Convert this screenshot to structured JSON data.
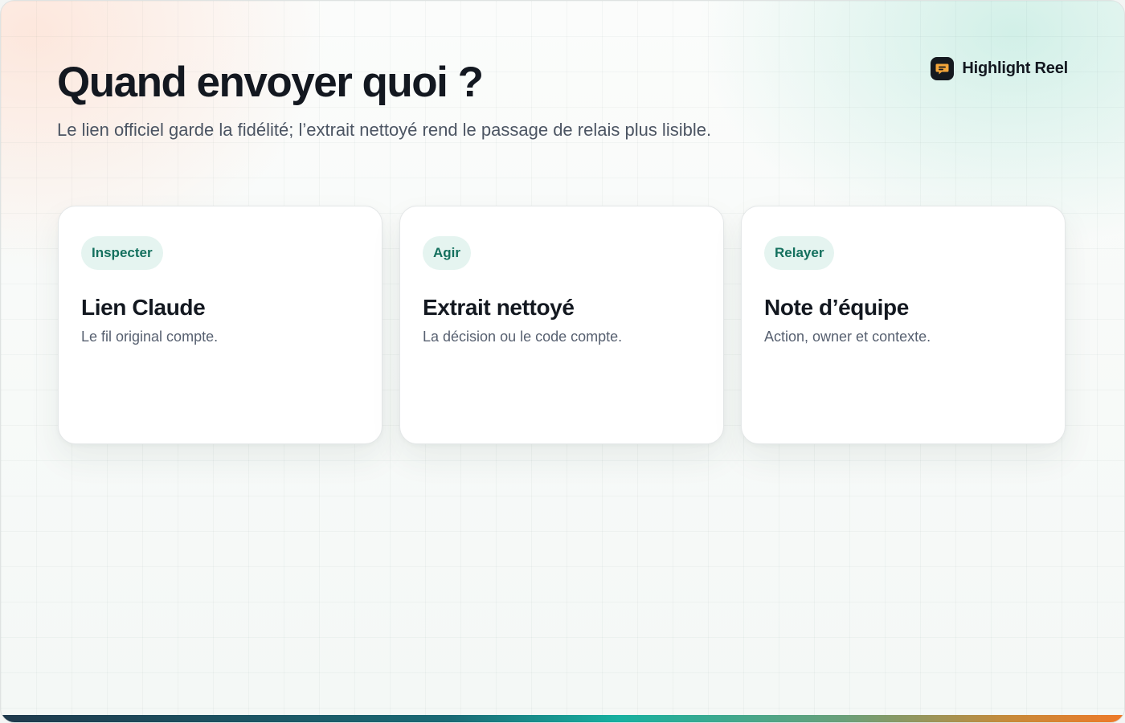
{
  "header": {
    "title": "Quand envoyer quoi ?",
    "subtitle": "Le lien officiel garde la fidélité; l’extrait nettoyé rend le passage de relais plus lisible."
  },
  "brand": {
    "name": "Highlight Reel",
    "icon": "speech-bubble-icon"
  },
  "cards": [
    {
      "tag": "Inspecter",
      "title": "Lien Claude",
      "description": "Le fil original compte."
    },
    {
      "tag": "Agir",
      "title": "Extrait nettoyé",
      "description": "La décision ou le code compte."
    },
    {
      "tag": "Relayer",
      "title": "Note d’équipe",
      "description": "Action, owner et contexte."
    }
  ],
  "colors": {
    "accent": "#14705e",
    "pill_background": "#e5f4f0",
    "title_text": "#131820",
    "bottom_gradient_start": "#1f3a4d",
    "bottom_gradient_mid": "#17b0a0",
    "bottom_gradient_end": "#ee7a2a"
  }
}
